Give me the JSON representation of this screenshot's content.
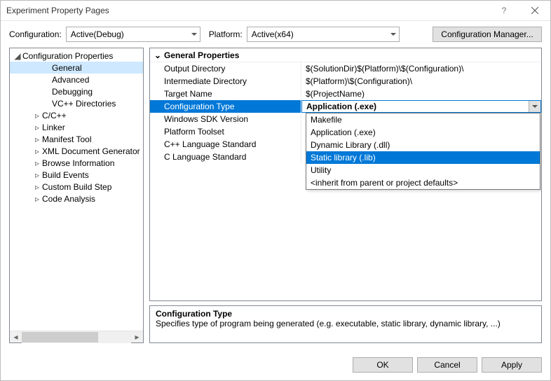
{
  "window": {
    "title": "Experiment Property Pages"
  },
  "toolbar": {
    "config_label": "Configuration:",
    "config_value": "Active(Debug)",
    "platform_label": "Platform:",
    "platform_value": "Active(x64)",
    "config_manager": "Configuration Manager..."
  },
  "tree": {
    "root": "Configuration Properties",
    "items": [
      {
        "label": "General",
        "indent": 2,
        "glyph": "",
        "sel": true
      },
      {
        "label": "Advanced",
        "indent": 2,
        "glyph": ""
      },
      {
        "label": "Debugging",
        "indent": 2,
        "glyph": ""
      },
      {
        "label": "VC++ Directories",
        "indent": 2,
        "glyph": ""
      },
      {
        "label": "C/C++",
        "indent": 1,
        "glyph": "▹"
      },
      {
        "label": "Linker",
        "indent": 1,
        "glyph": "▹"
      },
      {
        "label": "Manifest Tool",
        "indent": 1,
        "glyph": "▹"
      },
      {
        "label": "XML Document Generator",
        "indent": 1,
        "glyph": "▹"
      },
      {
        "label": "Browse Information",
        "indent": 1,
        "glyph": "▹"
      },
      {
        "label": "Build Events",
        "indent": 1,
        "glyph": "▹"
      },
      {
        "label": "Custom Build Step",
        "indent": 1,
        "glyph": "▹"
      },
      {
        "label": "Code Analysis",
        "indent": 1,
        "glyph": "▹"
      }
    ]
  },
  "grid": {
    "section": "General Properties",
    "rows": [
      {
        "name": "Output Directory",
        "value": "$(SolutionDir)$(Platform)\\$(Configuration)\\"
      },
      {
        "name": "Intermediate Directory",
        "value": "$(Platform)\\$(Configuration)\\"
      },
      {
        "name": "Target Name",
        "value": "$(ProjectName)"
      },
      {
        "name": "Configuration Type",
        "value": "Application (.exe)",
        "sel": true
      },
      {
        "name": "Windows SDK Version",
        "value": ""
      },
      {
        "name": "Platform Toolset",
        "value": ""
      },
      {
        "name": "C++ Language Standard",
        "value": ""
      },
      {
        "name": "C Language Standard",
        "value": ""
      }
    ]
  },
  "dropdown": {
    "items": [
      {
        "label": "Makefile"
      },
      {
        "label": "Application (.exe)"
      },
      {
        "label": "Dynamic Library (.dll)"
      },
      {
        "label": "Static library (.lib)",
        "sel": true
      },
      {
        "label": "Utility"
      },
      {
        "label": "<inherit from parent or project defaults>"
      }
    ]
  },
  "desc": {
    "title": "Configuration Type",
    "text": "Specifies type of program being generated (e.g. executable, static library, dynamic library, ...)"
  },
  "footer": {
    "ok": "OK",
    "cancel": "Cancel",
    "apply": "Apply"
  }
}
